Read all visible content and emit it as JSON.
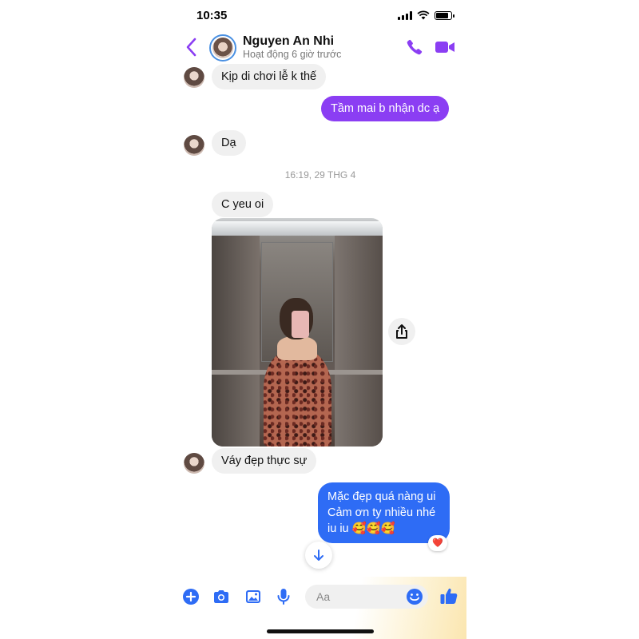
{
  "status_bar": {
    "time": "10:35",
    "battery_level": 0.85
  },
  "header": {
    "contact_name": "Nguyen An Nhi",
    "contact_status": "Hoạt động 6 giờ trước",
    "accent_color": "#8b3ef3",
    "icons": [
      "chevron-left-icon",
      "phone-icon",
      "video-camera-icon"
    ]
  },
  "messages": [
    {
      "side": "in",
      "text": "Kịp di chơi lễ k thế",
      "avatar": true
    },
    {
      "side": "out",
      "text": "Tầm mai b nhận dc ạ",
      "color": "#8b3ef3"
    },
    {
      "side": "in",
      "text": "Dạ",
      "avatar": true
    },
    {
      "side": "timestamp",
      "text": "16:19, 29 THG 4"
    },
    {
      "side": "in",
      "text": "C yeu oi",
      "avatar": false
    },
    {
      "side": "in",
      "type": "photo",
      "description_hidden": true
    },
    {
      "side": "in",
      "text": "Váy đẹp thực sự",
      "avatar": true
    },
    {
      "side": "out",
      "lines": [
        "Mặc đẹp quá nàng ui",
        "Cảm ơn ty nhiều nhé",
        "iu iu 🥰🥰🥰"
      ],
      "color": "#2e6cf5",
      "reaction": "❤️"
    }
  ],
  "composer": {
    "placeholder": "Aa",
    "icons": [
      "plus-circle-icon",
      "camera-icon",
      "image-icon",
      "microphone-icon",
      "emoji-icon",
      "thumbs-up-icon"
    ],
    "icon_color": "#2e6cf5"
  }
}
